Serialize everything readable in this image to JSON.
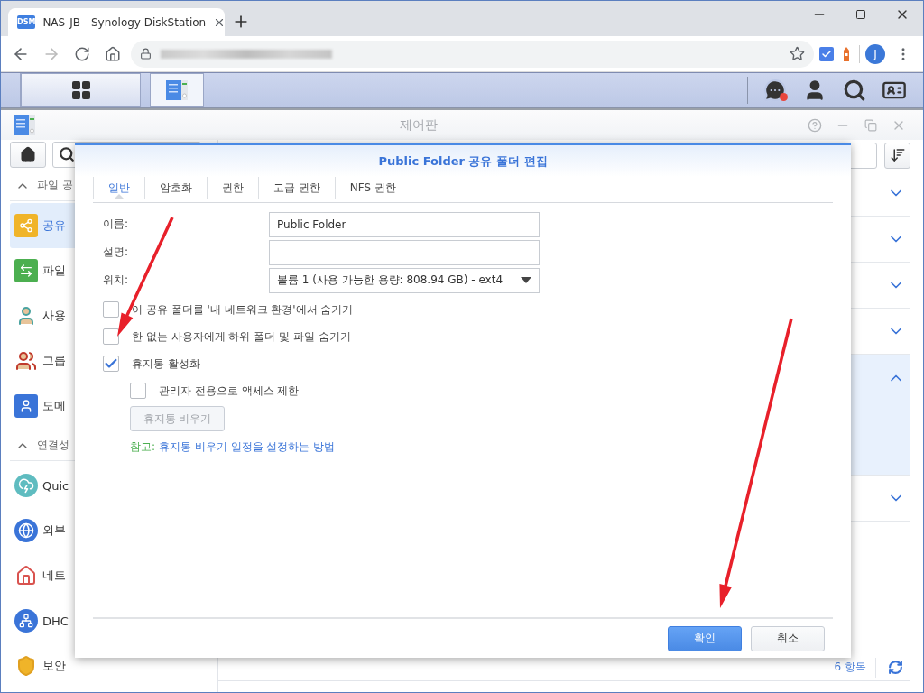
{
  "browser": {
    "tab": {
      "favicon_text": "DSM",
      "title": "NAS-JB - Synology DiskStation"
    },
    "avatar": "J"
  },
  "control_panel": {
    "title": "제어판",
    "sidebar": {
      "sections": [
        {
          "title": "파일 공",
          "expanded": true,
          "items": [
            {
              "label": "공유",
              "selected": true
            },
            {
              "label": "파일",
              "selected": false
            },
            {
              "label": "사용",
              "selected": false
            },
            {
              "label": "그룹",
              "selected": false
            },
            {
              "label": "도메",
              "selected": false
            }
          ]
        },
        {
          "title": "연결성",
          "expanded": true,
          "items": [
            {
              "label": "Quic",
              "selected": false
            },
            {
              "label": "외부",
              "selected": false
            },
            {
              "label": "네트",
              "selected": false
            },
            {
              "label": "DHC",
              "selected": false
            },
            {
              "label": "보안",
              "selected": false
            }
          ]
        }
      ]
    },
    "list": {
      "rows": [
        {
          "expanded": false,
          "selected": false
        },
        {
          "expanded": false,
          "selected": false
        },
        {
          "expanded": false,
          "selected": false
        },
        {
          "expanded": false,
          "selected": false
        },
        {
          "expanded": true,
          "selected": true
        },
        {
          "expanded": false,
          "selected": false
        }
      ],
      "count": "6 항목"
    }
  },
  "dialog": {
    "title": "Public Folder 공유 폴더 편집",
    "tabs": [
      {
        "label": "일반",
        "selected": true
      },
      {
        "label": "암호화",
        "selected": false
      },
      {
        "label": "권한",
        "selected": false
      },
      {
        "label": "고급 권한",
        "selected": false
      },
      {
        "label": "NFS 권한",
        "selected": false
      }
    ],
    "fields": [
      {
        "label": "이름:",
        "kind": "text",
        "value": "Public Folder"
      },
      {
        "label": "설명:",
        "kind": "text"
      },
      {
        "label": "위치:",
        "kind": "select",
        "value": "볼륨 1 (사용 가능한 용량: 808.94 GB) - ext4"
      }
    ],
    "options": [
      {
        "label": "이 공유 폴더를 '내 네트워크 환경'에서 숨기기",
        "checked": false
      },
      {
        "label": "한 없는 사용자에게 하위 폴더 및 파일 숨기기",
        "checked": false
      },
      {
        "label": "휴지통 활성화",
        "checked": true,
        "children": [
          {
            "label": "관리자 전용으로 액세스 제한",
            "checked": false
          }
        ]
      }
    ],
    "empty_trash_button": {
      "label": "휴지통 비우기",
      "disabled": true
    },
    "note": {
      "label": "참고:",
      "link": "휴지통 비우기 일정을 설정하는 방법"
    },
    "buttons": [
      {
        "label": "확인",
        "kind": "primary"
      },
      {
        "label": "취소",
        "kind": "secondary"
      }
    ]
  }
}
